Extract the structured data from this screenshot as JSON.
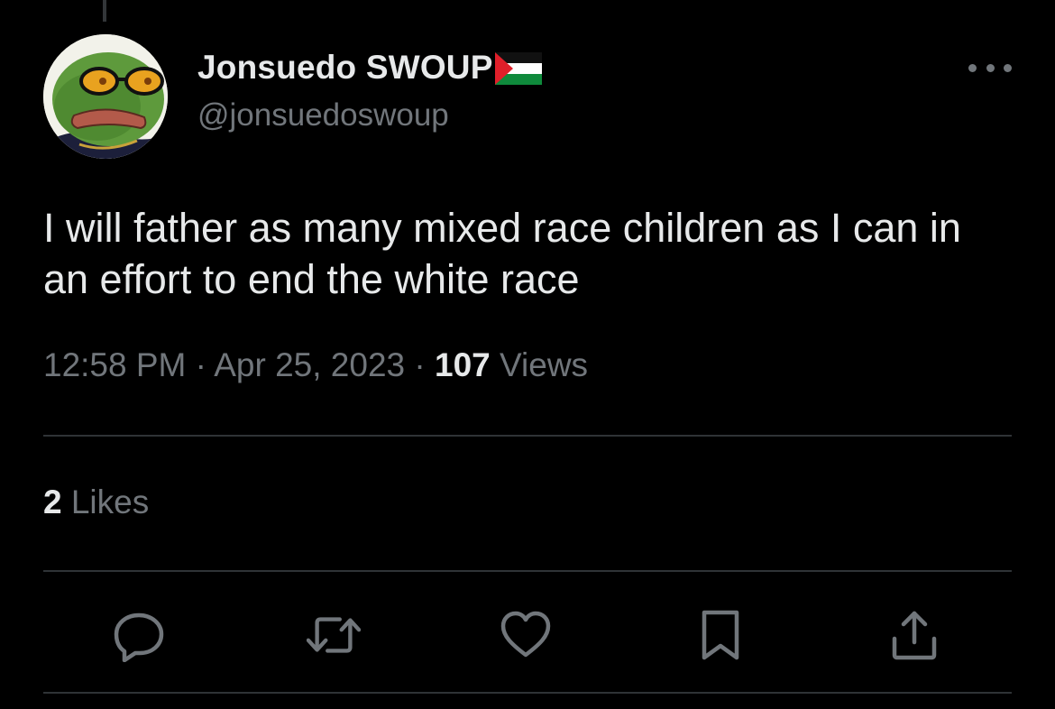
{
  "tweet": {
    "author": {
      "display_name": "Jonsuedo SWOUP",
      "handle": "@jonsuedoswoup",
      "avatar_icon": "pepe-frog-with-sunglasses-avatar",
      "flag_icon": "palestine-flag-icon"
    },
    "text": "I will father as many mixed race children as I can in an effort to end the white race",
    "time": "12:58 PM",
    "separator": "·",
    "date": "Apr 25, 2023",
    "views_count": "107",
    "views_label": "Views",
    "likes_count": "2",
    "likes_label": "Likes"
  },
  "actions": [
    {
      "name": "reply",
      "icon": "reply-icon"
    },
    {
      "name": "retweet",
      "icon": "retweet-icon"
    },
    {
      "name": "like",
      "icon": "heart-icon"
    },
    {
      "name": "bookmark",
      "icon": "bookmark-icon"
    },
    {
      "name": "share",
      "icon": "share-icon"
    }
  ],
  "colors": {
    "background": "#000000",
    "primary_text": "#e7e9ea",
    "secondary_text": "#71767b",
    "divider": "#2f3336"
  }
}
